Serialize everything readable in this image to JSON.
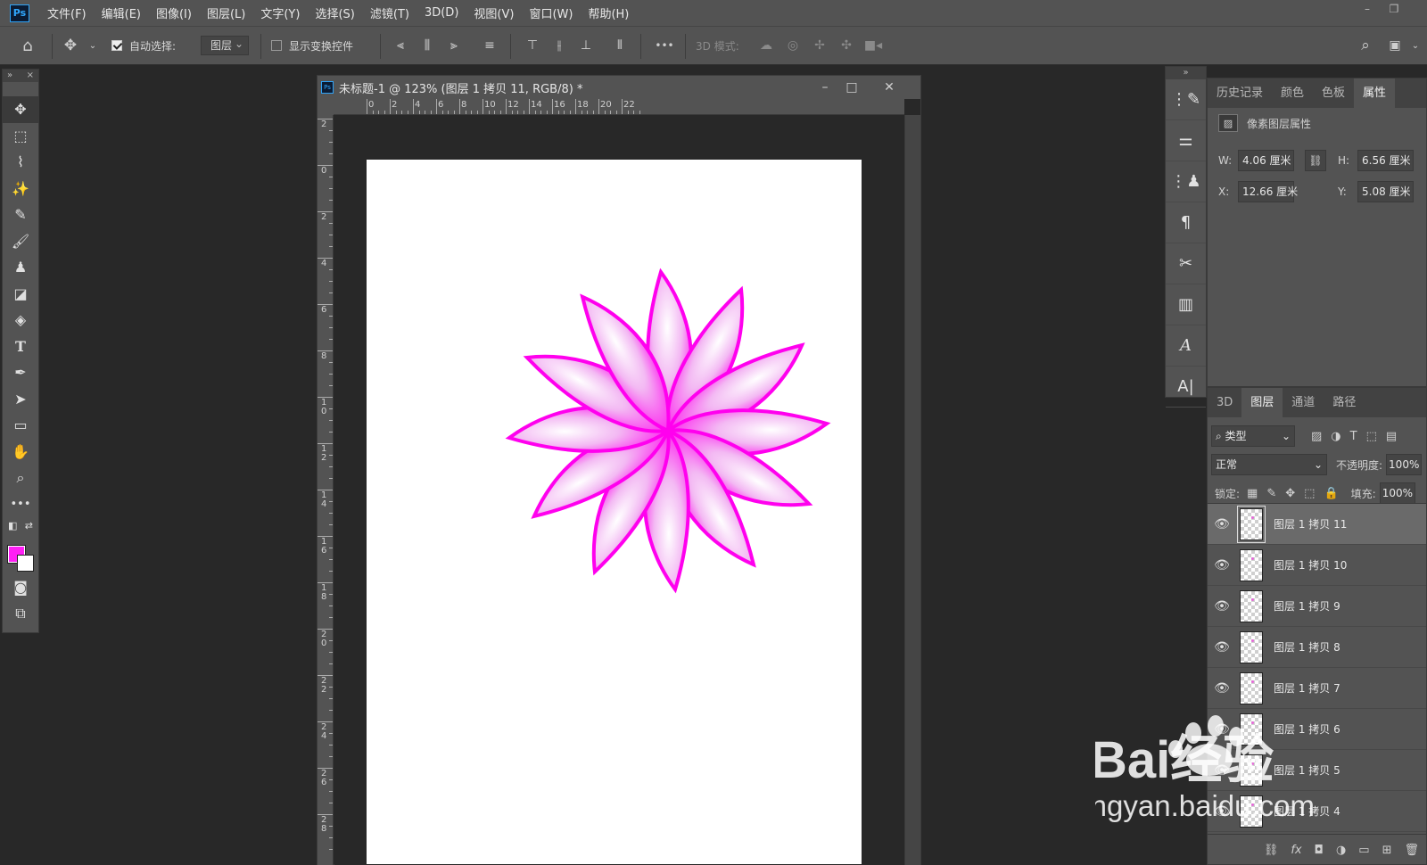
{
  "app": {
    "logo": "Ps"
  },
  "menu": [
    "文件(F)",
    "编辑(E)",
    "图像(I)",
    "图层(L)",
    "文字(Y)",
    "选择(S)",
    "滤镜(T)",
    "3D(D)",
    "视图(V)",
    "窗口(W)",
    "帮助(H)"
  ],
  "options": {
    "auto_select_label": "自动选择:",
    "auto_select_value": "图层",
    "show_transform_label": "显示变换控件",
    "more": "•••",
    "mode_3d_label": "3D 模式:"
  },
  "document": {
    "title": "未标题-1 @ 123% (图层 1 拷贝 11, RGB/8) *",
    "ruler_top": [
      "0",
      "2",
      "4",
      "6",
      "8",
      "10",
      "12",
      "14",
      "16",
      "18",
      "20",
      "22"
    ],
    "ruler_left": [
      "2",
      "0",
      "2",
      "4",
      "6",
      "8",
      "1\n0",
      "1\n2",
      "1\n4",
      "1\n6",
      "1\n8",
      "2\n0",
      "2\n2",
      "2\n4",
      "2\n6",
      "2\n8"
    ],
    "flower_color": "#ff00ee"
  },
  "colors": {
    "foreground": "#ff1ff5",
    "background": "#ffffff"
  },
  "properties_panel": {
    "tabs": [
      "历史记录",
      "颜色",
      "色板",
      "属性"
    ],
    "active_tab": "属性",
    "section_title": "像素图层属性",
    "w_label": "W:",
    "w_value": "4.06 厘米",
    "h_label": "H:",
    "h_value": "6.56 厘米",
    "x_label": "X:",
    "x_value": "12.66 厘米",
    "y_label": "Y:",
    "y_value": "5.08 厘米"
  },
  "layers_panel": {
    "tabs": [
      "3D",
      "图层",
      "通道",
      "路径"
    ],
    "active_tab": "图层",
    "filter_label": "类型",
    "blend_mode": "正常",
    "opacity_label": "不透明度:",
    "opacity_value": "100%",
    "lock_label": "锁定:",
    "fill_label": "填充:",
    "fill_value": "100%",
    "layers": [
      {
        "name": "图层 1 拷贝 11",
        "selected": true
      },
      {
        "name": "图层 1 拷贝 10",
        "selected": false
      },
      {
        "name": "图层 1 拷贝 9",
        "selected": false
      },
      {
        "name": "图层 1 拷贝 8",
        "selected": false
      },
      {
        "name": "图层 1 拷贝 7",
        "selected": false
      },
      {
        "name": "图层 1 拷贝 6",
        "selected": false
      },
      {
        "name": "图层 1 拷贝 5",
        "selected": false
      },
      {
        "name": "图层 1 拷贝 4",
        "selected": false
      }
    ]
  },
  "watermark": {
    "brand": "Bai经验",
    "url": "jingyan.baidu.com"
  }
}
